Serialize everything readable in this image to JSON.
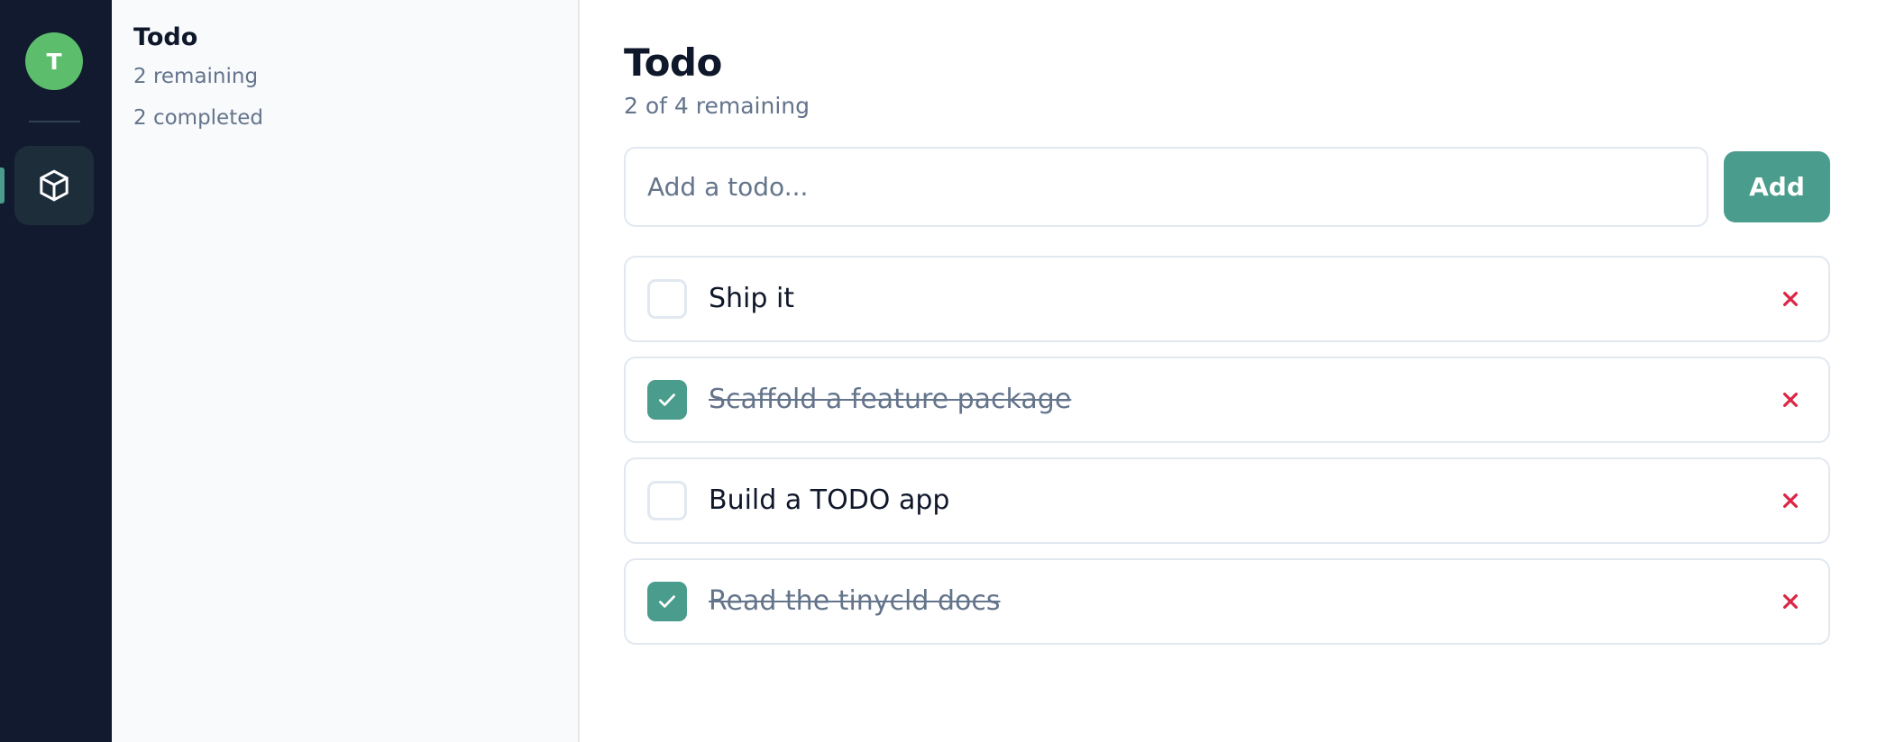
{
  "rail": {
    "avatar_initial": "T",
    "items": [
      {
        "icon": "cube-icon",
        "active": true
      }
    ]
  },
  "sidebar": {
    "title": "Todo",
    "remaining": "2 remaining",
    "completed": "2 completed"
  },
  "main": {
    "title": "Todo",
    "subtitle": "2 of 4 remaining",
    "add_placeholder": "Add a todo...",
    "add_label": "Add",
    "todos": [
      {
        "text": "Ship it",
        "done": false
      },
      {
        "text": "Scaffold a feature package",
        "done": true
      },
      {
        "text": "Build a TODO app",
        "done": false
      },
      {
        "text": "Read the tinycld docs",
        "done": true
      }
    ]
  },
  "colors": {
    "accent": "#4a9c8c",
    "rail_bg": "#111a2e",
    "avatar": "#5cbe6c",
    "delete": "#dc2646"
  }
}
